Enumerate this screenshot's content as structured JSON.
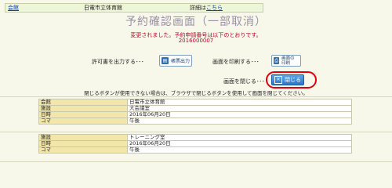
{
  "header": {
    "facility_link": "会館",
    "facility_name": "日電市立体育館",
    "details_prefix": "詳細は",
    "details_link": "こちら"
  },
  "title": "予約確認画面（一部取消）",
  "message": {
    "line1": "変更されました。予約申請番号は以下のとおりです。",
    "reservation_number": "2016000007"
  },
  "actions": {
    "permit_label": "許可書を出力する･･･",
    "permit_button": "帳票出力",
    "print_label": "画面を印刷する･･･",
    "print_button": "画面の印刷",
    "close_label": "画面を閉じる･･･",
    "close_button": "閉じる"
  },
  "notice": "閉じるボタンが使用できない場合は、ブラウザで閉じるボタンを使用して画面を閉じてください。",
  "table1": {
    "rows": [
      {
        "key": "会館",
        "value": "日電市立体育館"
      },
      {
        "key": "施設",
        "value": "大会議室"
      },
      {
        "key": "日時",
        "value": "2016年06月20日"
      },
      {
        "key": "コマ",
        "value": "午後"
      }
    ]
  },
  "table2": {
    "rows": [
      {
        "key": "施設",
        "value": "トレーニング室"
      },
      {
        "key": "日時",
        "value": "2016年06月20日"
      },
      {
        "key": "コマ",
        "value": "午後"
      }
    ]
  },
  "colors": {
    "accent_red": "#c0002a",
    "highlight_ring": "#e00010",
    "close_button_blue": "#2d78c8"
  }
}
